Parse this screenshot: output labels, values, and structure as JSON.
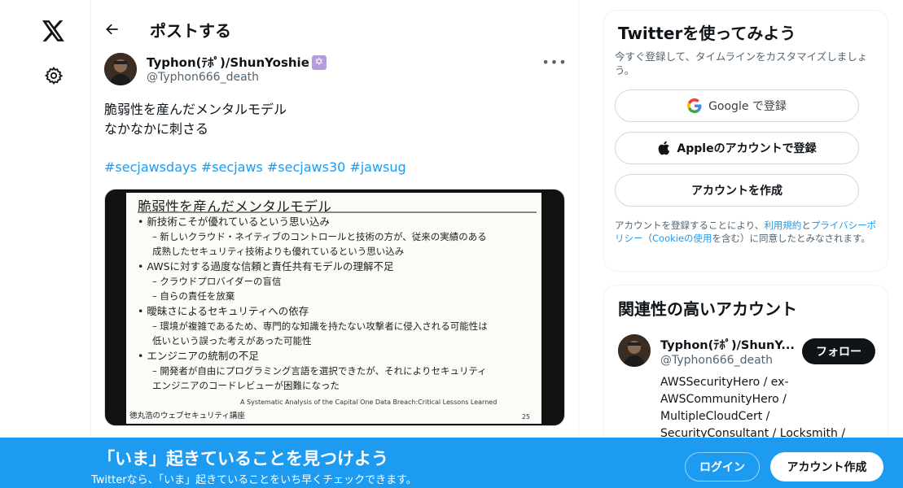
{
  "nav": {
    "logo_icon": "x-logo-icon",
    "settings_icon": "gear-icon"
  },
  "header": {
    "back_icon": "arrow-left-icon",
    "title": "ポストする"
  },
  "tweet": {
    "author_name": "Typhon(ﾃﾎﾟ)/ShunYoshie",
    "author_badge_icon": "star-of-david-icon",
    "author_handle": "@Typhon666_death",
    "more_icon": "more-dots-icon",
    "text_line1": "脆弱性を産んだメンタルモデル",
    "text_line2": "なかなかに刺さる",
    "hashtags": [
      "#secjawsdays",
      "#secjaws",
      "#secjaws30",
      "#jawsug"
    ],
    "slide": {
      "title": "脆弱性を産んだメンタルモデル",
      "lines": [
        {
          "kind": "b",
          "text": "• 新技術こそが優れているという思い込み"
        },
        {
          "kind": "s",
          "text": "– 新しいクラウド・ネイティブのコントロールと技術の方が、従来の実績のある"
        },
        {
          "kind": "s",
          "text": "成熟したセキュリティ技術よりも優れているという思い込み"
        },
        {
          "kind": "b",
          "text": "• AWSに対する過度な信頼と責任共有モデルの理解不足"
        },
        {
          "kind": "s",
          "text": "– クラウドプロバイダーの盲信"
        },
        {
          "kind": "s",
          "text": "– 自らの責任を放棄"
        },
        {
          "kind": "b",
          "text": "• 曖昧さによるセキュリティへの依存"
        },
        {
          "kind": "s",
          "text": "– 環境が複雑であるため、専門的な知識を持たない攻撃者に侵入される可能性は"
        },
        {
          "kind": "s",
          "text": "低いという誤った考えがあった可能性"
        },
        {
          "kind": "b",
          "text": "• エンジニアの統制の不足"
        },
        {
          "kind": "s",
          "text": "– 開発者が自由にプログラミング言語を選択できたが、それによりセキュリティ"
        },
        {
          "kind": "s",
          "text": "エンジニアのコードレビューが困難になった"
        }
      ],
      "footer": "A Systematic Analysis of the Capital One Data Breach:Critical Lessons Learned",
      "author": "徳丸浩のウェブセキュリティ講座",
      "page": "25"
    }
  },
  "signup_card": {
    "title": "Twitterを使ってみよう",
    "subtitle": "今すぐ登録して、タイムラインをカスタマイズしましょう。",
    "google_label": "Google で登録",
    "apple_label": "Appleのアカウントで登録",
    "create_label": "アカウントを作成",
    "legal_prefix": "アカウントを登録することにより、",
    "terms_link": "利用規約",
    "legal_and": "と",
    "privacy_link": "プライバシーポリシー",
    "legal_open": "（",
    "cookie_link": "Cookieの使用",
    "legal_suffix": "を含む）に同意したとみなされます。"
  },
  "related": {
    "title": "関連性の高いアカウント",
    "name": "Typhon(ﾃﾎﾟ)/ShunY...",
    "handle": "@Typhon666_death",
    "follow_label": "フォロー",
    "bio": "AWSSecurityHero / ex-AWSCommunityHero / MultipleCloudCert / SecurityConsultant / Locksmith /"
  },
  "banner": {
    "title": "「いま」起きていることを見つけよう",
    "subtitle": "Twitterなら、「いま」起きていることをいち早くチェックできます。",
    "login_label": "ログイン",
    "signup_label": "アカウント作成"
  },
  "colors": {
    "accent": "#1d9bf0",
    "text": "#0f1419",
    "muted": "#536471"
  }
}
